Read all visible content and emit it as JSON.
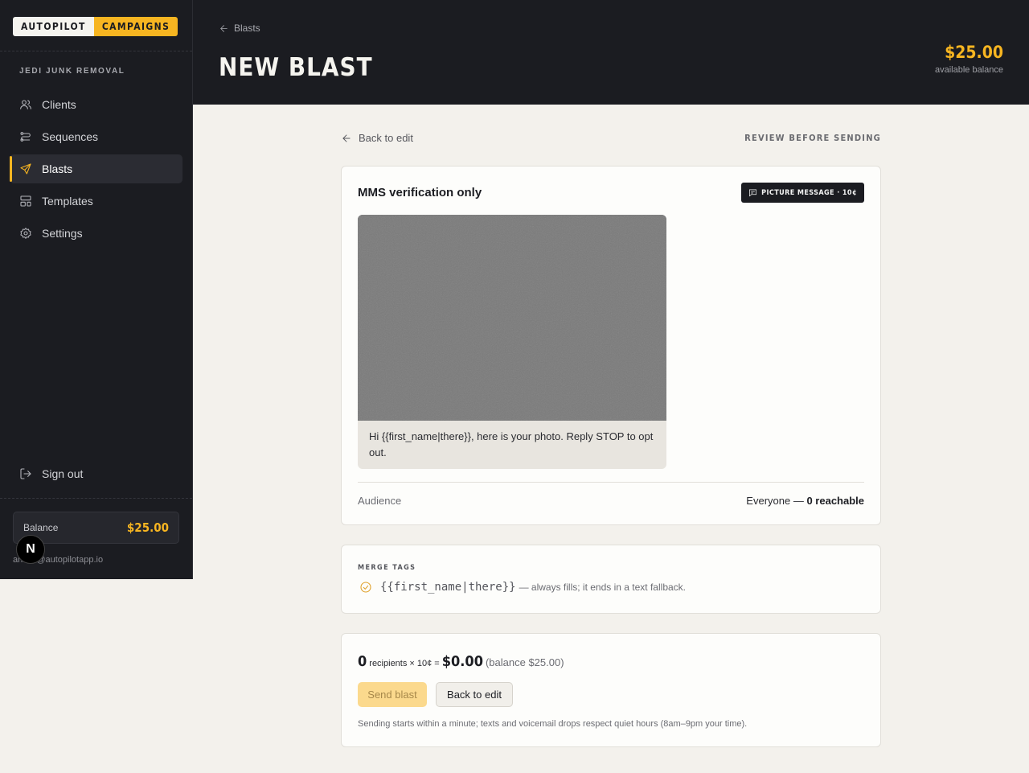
{
  "sidebar": {
    "logo_left": "AUTOPILOT",
    "logo_right": "CAMPAIGNS",
    "org_name": "JEDI JUNK REMOVAL",
    "items": [
      {
        "label": "Clients",
        "icon": "users-icon"
      },
      {
        "label": "Sequences",
        "icon": "sequences-icon"
      },
      {
        "label": "Blasts",
        "icon": "send-icon",
        "active": true
      },
      {
        "label": "Templates",
        "icon": "templates-icon"
      },
      {
        "label": "Settings",
        "icon": "gear-icon"
      }
    ],
    "sign_out": "Sign out",
    "balance_label": "Balance",
    "balance_value": "$25.00",
    "email": "an...w@autopilotapp.io",
    "n_badge": "N"
  },
  "header": {
    "breadcrumb": "Blasts",
    "title": "NEW BLAST",
    "balance": "$25.00",
    "balance_caption": "available balance"
  },
  "main": {
    "back_link": "Back to edit",
    "review_label": "REVIEW BEFORE SENDING",
    "message": {
      "title": "MMS verification only",
      "badge": "PICTURE MESSAGE · 10¢",
      "body": "Hi {{first_name|there}}, here is your photo. Reply STOP to opt out.",
      "audience_label": "Audience",
      "audience_value_prefix": "Everyone — ",
      "audience_value_bold": "0 reachable"
    },
    "merge_tags": {
      "heading": "MERGE TAGS",
      "tag": "{{first_name|there}}",
      "description": "— always fills; it ends in a text fallback."
    },
    "summary": {
      "recipients_count": "0",
      "recipients_text": "recipients × 10¢ =",
      "total": "$0.00",
      "balance_note": "(balance $25.00)",
      "send_button": "Send blast",
      "back_button": "Back to edit",
      "note": "Sending starts within a minute; texts and voicemail drops respect quiet hours (8am–9pm your time)."
    }
  },
  "colors": {
    "accent": "#f7b521",
    "dark": "#1b1c21",
    "page_bg": "#f3f1ec"
  }
}
